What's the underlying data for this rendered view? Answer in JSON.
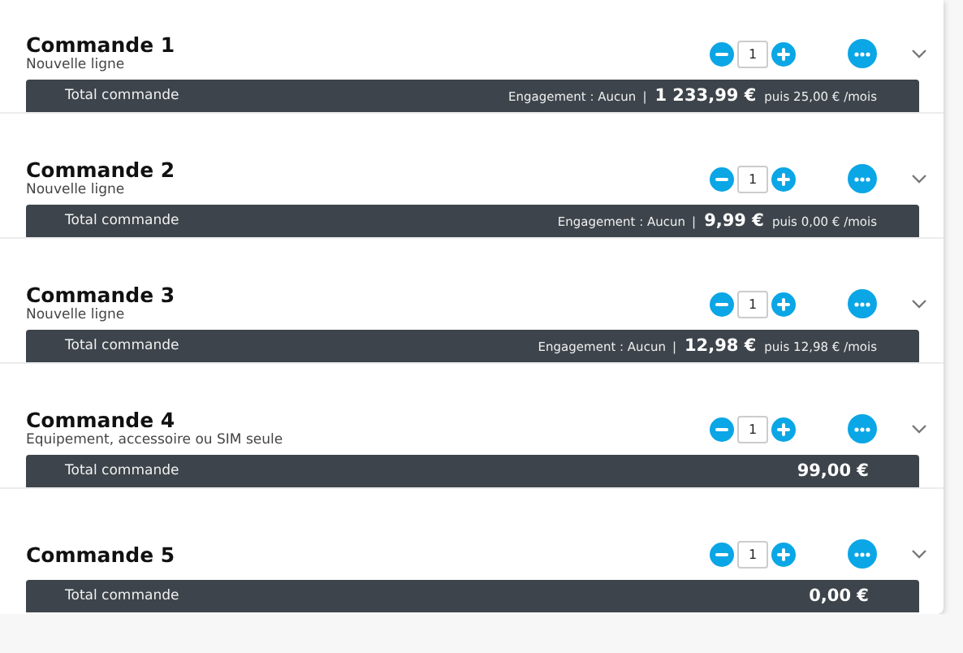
{
  "orders": [
    {
      "title": "Commande 1",
      "subtitle": "Nouvelle ligne",
      "quantity": "1",
      "total_label": "Total commande",
      "engagement": "Engagement : Aucun",
      "separator": "|",
      "price": "1 233,99 €",
      "monthly": "puis 25,00 € /mois"
    },
    {
      "title": "Commande 2",
      "subtitle": "Nouvelle ligne",
      "quantity": "1",
      "total_label": "Total commande",
      "engagement": "Engagement : Aucun",
      "separator": "|",
      "price": "9,99 €",
      "monthly": "puis 0,00 € /mois"
    },
    {
      "title": "Commande 3",
      "subtitle": "Nouvelle ligne",
      "quantity": "1",
      "total_label": "Total commande",
      "engagement": "Engagement : Aucun",
      "separator": "|",
      "price": "12,98 €",
      "monthly": "puis 12,98 € /mois"
    },
    {
      "title": "Commande 4",
      "subtitle": "Equipement, accessoire ou SIM seule",
      "quantity": "1",
      "total_label": "Total commande",
      "price": "99,00 €"
    },
    {
      "title": "Commande 5",
      "quantity": "1",
      "total_label": "Total commande",
      "price": "0,00 €"
    }
  ]
}
